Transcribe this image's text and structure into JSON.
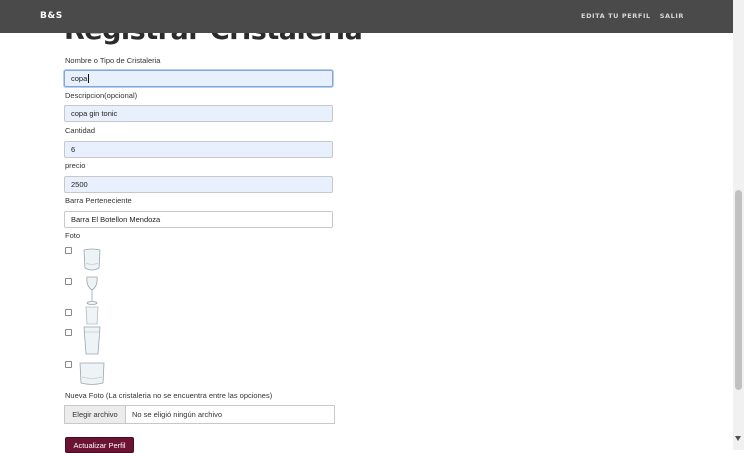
{
  "nav": {
    "brand": "B&S",
    "links": [
      "EDITA TU PERFIL",
      "SALIR"
    ]
  },
  "page": {
    "title": "Registrar Cristaleria"
  },
  "form": {
    "fields": [
      {
        "label": "Nombre o Tipo de Cristaleria",
        "value": "copa"
      },
      {
        "label": "Descripcion(opcional)",
        "value": "copa gin tonic"
      },
      {
        "label": "Cantidad",
        "value": "6"
      },
      {
        "label": "precio",
        "value": "2500"
      },
      {
        "label": "Barra Perteneciente",
        "value": "Barra El Botellon Mendoza"
      }
    ],
    "foto_label": "Foto",
    "glass_options": [
      {
        "icon": "tumbler-glass-icon",
        "checked": false
      },
      {
        "icon": "wine-glass-icon",
        "checked": false
      },
      {
        "icon": "shot-glass-icon",
        "checked": false
      },
      {
        "icon": "pint-glass-icon",
        "checked": false
      },
      {
        "icon": "rocks-glass-icon",
        "checked": false
      }
    ],
    "new_photo_label": "Nueva Foto (La cristaleria no se encuentra entre las opciones)",
    "file_button": "Elegir archivo",
    "file_status": "No se eligió ningún archivo",
    "submit": "Actualizar Perfil"
  }
}
